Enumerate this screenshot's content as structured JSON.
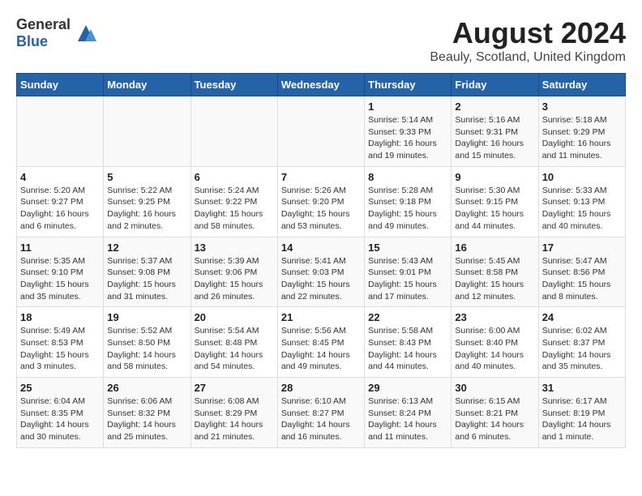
{
  "header": {
    "logo_general": "General",
    "logo_blue": "Blue",
    "title": "August 2024",
    "subtitle": "Beauly, Scotland, United Kingdom"
  },
  "days_of_week": [
    "Sunday",
    "Monday",
    "Tuesday",
    "Wednesday",
    "Thursday",
    "Friday",
    "Saturday"
  ],
  "weeks": [
    [
      {
        "day": "",
        "info": ""
      },
      {
        "day": "",
        "info": ""
      },
      {
        "day": "",
        "info": ""
      },
      {
        "day": "",
        "info": ""
      },
      {
        "day": "1",
        "info": "Sunrise: 5:14 AM\nSunset: 9:33 PM\nDaylight: 16 hours\nand 19 minutes."
      },
      {
        "day": "2",
        "info": "Sunrise: 5:16 AM\nSunset: 9:31 PM\nDaylight: 16 hours\nand 15 minutes."
      },
      {
        "day": "3",
        "info": "Sunrise: 5:18 AM\nSunset: 9:29 PM\nDaylight: 16 hours\nand 11 minutes."
      }
    ],
    [
      {
        "day": "4",
        "info": "Sunrise: 5:20 AM\nSunset: 9:27 PM\nDaylight: 16 hours\nand 6 minutes."
      },
      {
        "day": "5",
        "info": "Sunrise: 5:22 AM\nSunset: 9:25 PM\nDaylight: 16 hours\nand 2 minutes."
      },
      {
        "day": "6",
        "info": "Sunrise: 5:24 AM\nSunset: 9:22 PM\nDaylight: 15 hours\nand 58 minutes."
      },
      {
        "day": "7",
        "info": "Sunrise: 5:26 AM\nSunset: 9:20 PM\nDaylight: 15 hours\nand 53 minutes."
      },
      {
        "day": "8",
        "info": "Sunrise: 5:28 AM\nSunset: 9:18 PM\nDaylight: 15 hours\nand 49 minutes."
      },
      {
        "day": "9",
        "info": "Sunrise: 5:30 AM\nSunset: 9:15 PM\nDaylight: 15 hours\nand 44 minutes."
      },
      {
        "day": "10",
        "info": "Sunrise: 5:33 AM\nSunset: 9:13 PM\nDaylight: 15 hours\nand 40 minutes."
      }
    ],
    [
      {
        "day": "11",
        "info": "Sunrise: 5:35 AM\nSunset: 9:10 PM\nDaylight: 15 hours\nand 35 minutes."
      },
      {
        "day": "12",
        "info": "Sunrise: 5:37 AM\nSunset: 9:08 PM\nDaylight: 15 hours\nand 31 minutes."
      },
      {
        "day": "13",
        "info": "Sunrise: 5:39 AM\nSunset: 9:06 PM\nDaylight: 15 hours\nand 26 minutes."
      },
      {
        "day": "14",
        "info": "Sunrise: 5:41 AM\nSunset: 9:03 PM\nDaylight: 15 hours\nand 22 minutes."
      },
      {
        "day": "15",
        "info": "Sunrise: 5:43 AM\nSunset: 9:01 PM\nDaylight: 15 hours\nand 17 minutes."
      },
      {
        "day": "16",
        "info": "Sunrise: 5:45 AM\nSunset: 8:58 PM\nDaylight: 15 hours\nand 12 minutes."
      },
      {
        "day": "17",
        "info": "Sunrise: 5:47 AM\nSunset: 8:56 PM\nDaylight: 15 hours\nand 8 minutes."
      }
    ],
    [
      {
        "day": "18",
        "info": "Sunrise: 5:49 AM\nSunset: 8:53 PM\nDaylight: 15 hours\nand 3 minutes."
      },
      {
        "day": "19",
        "info": "Sunrise: 5:52 AM\nSunset: 8:50 PM\nDaylight: 14 hours\nand 58 minutes."
      },
      {
        "day": "20",
        "info": "Sunrise: 5:54 AM\nSunset: 8:48 PM\nDaylight: 14 hours\nand 54 minutes."
      },
      {
        "day": "21",
        "info": "Sunrise: 5:56 AM\nSunset: 8:45 PM\nDaylight: 14 hours\nand 49 minutes."
      },
      {
        "day": "22",
        "info": "Sunrise: 5:58 AM\nSunset: 8:43 PM\nDaylight: 14 hours\nand 44 minutes."
      },
      {
        "day": "23",
        "info": "Sunrise: 6:00 AM\nSunset: 8:40 PM\nDaylight: 14 hours\nand 40 minutes."
      },
      {
        "day": "24",
        "info": "Sunrise: 6:02 AM\nSunset: 8:37 PM\nDaylight: 14 hours\nand 35 minutes."
      }
    ],
    [
      {
        "day": "25",
        "info": "Sunrise: 6:04 AM\nSunset: 8:35 PM\nDaylight: 14 hours\nand 30 minutes."
      },
      {
        "day": "26",
        "info": "Sunrise: 6:06 AM\nSunset: 8:32 PM\nDaylight: 14 hours\nand 25 minutes."
      },
      {
        "day": "27",
        "info": "Sunrise: 6:08 AM\nSunset: 8:29 PM\nDaylight: 14 hours\nand 21 minutes."
      },
      {
        "day": "28",
        "info": "Sunrise: 6:10 AM\nSunset: 8:27 PM\nDaylight: 14 hours\nand 16 minutes."
      },
      {
        "day": "29",
        "info": "Sunrise: 6:13 AM\nSunset: 8:24 PM\nDaylight: 14 hours\nand 11 minutes."
      },
      {
        "day": "30",
        "info": "Sunrise: 6:15 AM\nSunset: 8:21 PM\nDaylight: 14 hours\nand 6 minutes."
      },
      {
        "day": "31",
        "info": "Sunrise: 6:17 AM\nSunset: 8:19 PM\nDaylight: 14 hours\nand 1 minute."
      }
    ]
  ]
}
